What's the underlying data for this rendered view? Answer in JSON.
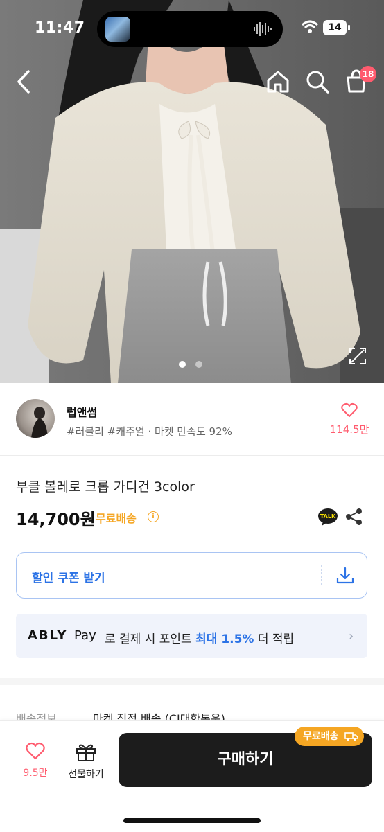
{
  "status_bar": {
    "time": "11:47",
    "battery": "14"
  },
  "nav": {
    "cart_badge": "18"
  },
  "gallery": {
    "page_count": 2,
    "active_page": 1
  },
  "seller": {
    "name": "럽앤썸",
    "tags": "#러블리 #캐주얼 · 마켓 만족도 92%",
    "likes": "114.5만"
  },
  "product": {
    "title": "부클 볼레로 크롭 가디건 3color",
    "price": "14,700원",
    "shipping_badge": "무료배송"
  },
  "coupon": {
    "label": "할인 쿠폰 받기"
  },
  "ably_pay": {
    "brand": "ABLY",
    "pay": "Pay",
    "text_pre": " 로 결제 시 포인트 ",
    "text_highlight": "최대 1.5%",
    "text_post": " 더 적립"
  },
  "shipping_info": {
    "label": "배송정보",
    "value": "마켓 직접 배송 (CJ대한통운)"
  },
  "bottom_bar": {
    "likes": "9.5만",
    "gift_label": "선물하기",
    "buy_label": "구매하기",
    "buy_badge": "무료배송"
  },
  "colors": {
    "accent_blue": "#2c73e6",
    "like_pink": "#ff5b6e",
    "ship_orange": "#f5a623",
    "buy_black": "#1c1c1c"
  }
}
